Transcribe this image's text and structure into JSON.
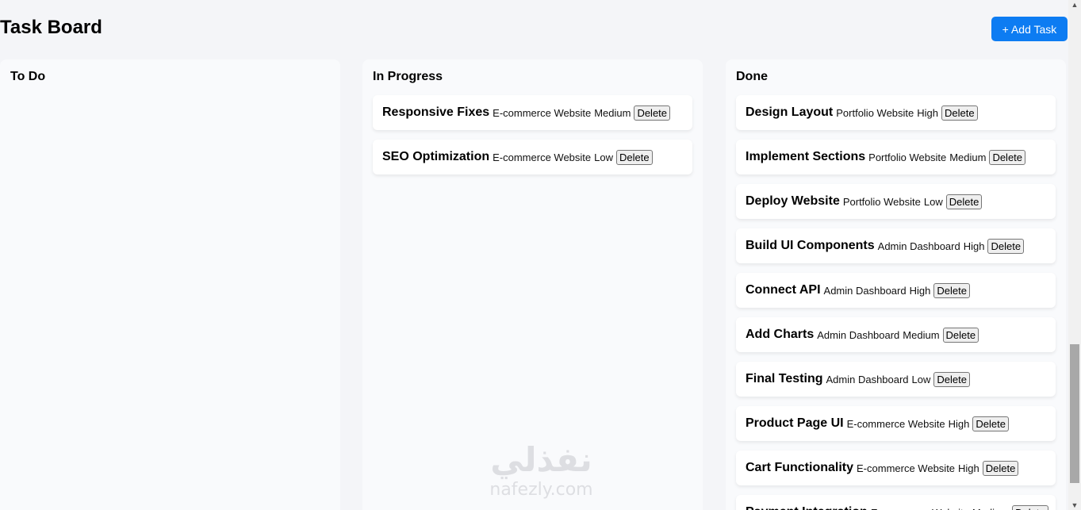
{
  "header": {
    "title": "Task Board",
    "add_button_label": "+ Add Task"
  },
  "columns": [
    {
      "title": "To Do",
      "tasks": []
    },
    {
      "title": "In Progress",
      "tasks": [
        {
          "title": "Responsive Fixes",
          "project": "E-commerce Website",
          "priority": "Medium",
          "delete_label": "Delete"
        },
        {
          "title": "SEO Optimization",
          "project": "E-commerce Website",
          "priority": "Low",
          "delete_label": "Delete"
        }
      ]
    },
    {
      "title": "Done",
      "tasks": [
        {
          "title": "Design Layout",
          "project": "Portfolio Website",
          "priority": "High",
          "delete_label": "Delete"
        },
        {
          "title": "Implement Sections",
          "project": "Portfolio Website",
          "priority": "Medium",
          "delete_label": "Delete"
        },
        {
          "title": "Deploy Website",
          "project": "Portfolio Website",
          "priority": "Low",
          "delete_label": "Delete"
        },
        {
          "title": "Build UI Components",
          "project": "Admin Dashboard",
          "priority": "High",
          "delete_label": "Delete"
        },
        {
          "title": "Connect API",
          "project": "Admin Dashboard",
          "priority": "High",
          "delete_label": "Delete"
        },
        {
          "title": "Add Charts",
          "project": "Admin Dashboard",
          "priority": "Medium",
          "delete_label": "Delete"
        },
        {
          "title": "Final Testing",
          "project": "Admin Dashboard",
          "priority": "Low",
          "delete_label": "Delete"
        },
        {
          "title": "Product Page UI",
          "project": "E-commerce Website",
          "priority": "High",
          "delete_label": "Delete"
        },
        {
          "title": "Cart Functionality",
          "project": "E-commerce Website",
          "priority": "High",
          "delete_label": "Delete"
        },
        {
          "title": "Payment Integration",
          "project": "E-commerce Website",
          "priority": "Medium",
          "delete_label": "Delete"
        }
      ]
    }
  ],
  "watermark": {
    "arabic": "نفذلي",
    "latin": "nafezly.com"
  },
  "colors": {
    "accent": "#0d7cf2",
    "page_background": "#f4f5f8",
    "column_background": "#f9fafc",
    "card_background": "#ffffff"
  },
  "icons": {
    "scroll_up": "arrow-up-icon",
    "scroll_down": "arrow-down-icon"
  }
}
